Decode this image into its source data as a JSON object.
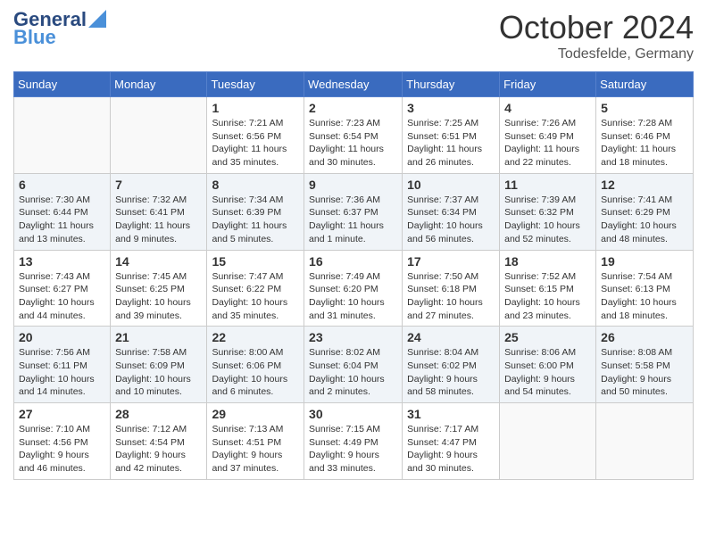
{
  "header": {
    "logo_line1": "General",
    "logo_line2": "Blue",
    "month": "October 2024",
    "location": "Todesfelde, Germany"
  },
  "days_of_week": [
    "Sunday",
    "Monday",
    "Tuesday",
    "Wednesday",
    "Thursday",
    "Friday",
    "Saturday"
  ],
  "weeks": [
    [
      {
        "day": "",
        "content": ""
      },
      {
        "day": "",
        "content": ""
      },
      {
        "day": "1",
        "content": "Sunrise: 7:21 AM\nSunset: 6:56 PM\nDaylight: 11 hours and 35 minutes."
      },
      {
        "day": "2",
        "content": "Sunrise: 7:23 AM\nSunset: 6:54 PM\nDaylight: 11 hours and 30 minutes."
      },
      {
        "day": "3",
        "content": "Sunrise: 7:25 AM\nSunset: 6:51 PM\nDaylight: 11 hours and 26 minutes."
      },
      {
        "day": "4",
        "content": "Sunrise: 7:26 AM\nSunset: 6:49 PM\nDaylight: 11 hours and 22 minutes."
      },
      {
        "day": "5",
        "content": "Sunrise: 7:28 AM\nSunset: 6:46 PM\nDaylight: 11 hours and 18 minutes."
      }
    ],
    [
      {
        "day": "6",
        "content": "Sunrise: 7:30 AM\nSunset: 6:44 PM\nDaylight: 11 hours and 13 minutes."
      },
      {
        "day": "7",
        "content": "Sunrise: 7:32 AM\nSunset: 6:41 PM\nDaylight: 11 hours and 9 minutes."
      },
      {
        "day": "8",
        "content": "Sunrise: 7:34 AM\nSunset: 6:39 PM\nDaylight: 11 hours and 5 minutes."
      },
      {
        "day": "9",
        "content": "Sunrise: 7:36 AM\nSunset: 6:37 PM\nDaylight: 11 hours and 1 minute."
      },
      {
        "day": "10",
        "content": "Sunrise: 7:37 AM\nSunset: 6:34 PM\nDaylight: 10 hours and 56 minutes."
      },
      {
        "day": "11",
        "content": "Sunrise: 7:39 AM\nSunset: 6:32 PM\nDaylight: 10 hours and 52 minutes."
      },
      {
        "day": "12",
        "content": "Sunrise: 7:41 AM\nSunset: 6:29 PM\nDaylight: 10 hours and 48 minutes."
      }
    ],
    [
      {
        "day": "13",
        "content": "Sunrise: 7:43 AM\nSunset: 6:27 PM\nDaylight: 10 hours and 44 minutes."
      },
      {
        "day": "14",
        "content": "Sunrise: 7:45 AM\nSunset: 6:25 PM\nDaylight: 10 hours and 39 minutes."
      },
      {
        "day": "15",
        "content": "Sunrise: 7:47 AM\nSunset: 6:22 PM\nDaylight: 10 hours and 35 minutes."
      },
      {
        "day": "16",
        "content": "Sunrise: 7:49 AM\nSunset: 6:20 PM\nDaylight: 10 hours and 31 minutes."
      },
      {
        "day": "17",
        "content": "Sunrise: 7:50 AM\nSunset: 6:18 PM\nDaylight: 10 hours and 27 minutes."
      },
      {
        "day": "18",
        "content": "Sunrise: 7:52 AM\nSunset: 6:15 PM\nDaylight: 10 hours and 23 minutes."
      },
      {
        "day": "19",
        "content": "Sunrise: 7:54 AM\nSunset: 6:13 PM\nDaylight: 10 hours and 18 minutes."
      }
    ],
    [
      {
        "day": "20",
        "content": "Sunrise: 7:56 AM\nSunset: 6:11 PM\nDaylight: 10 hours and 14 minutes."
      },
      {
        "day": "21",
        "content": "Sunrise: 7:58 AM\nSunset: 6:09 PM\nDaylight: 10 hours and 10 minutes."
      },
      {
        "day": "22",
        "content": "Sunrise: 8:00 AM\nSunset: 6:06 PM\nDaylight: 10 hours and 6 minutes."
      },
      {
        "day": "23",
        "content": "Sunrise: 8:02 AM\nSunset: 6:04 PM\nDaylight: 10 hours and 2 minutes."
      },
      {
        "day": "24",
        "content": "Sunrise: 8:04 AM\nSunset: 6:02 PM\nDaylight: 9 hours and 58 minutes."
      },
      {
        "day": "25",
        "content": "Sunrise: 8:06 AM\nSunset: 6:00 PM\nDaylight: 9 hours and 54 minutes."
      },
      {
        "day": "26",
        "content": "Sunrise: 8:08 AM\nSunset: 5:58 PM\nDaylight: 9 hours and 50 minutes."
      }
    ],
    [
      {
        "day": "27",
        "content": "Sunrise: 7:10 AM\nSunset: 4:56 PM\nDaylight: 9 hours and 46 minutes."
      },
      {
        "day": "28",
        "content": "Sunrise: 7:12 AM\nSunset: 4:54 PM\nDaylight: 9 hours and 42 minutes."
      },
      {
        "day": "29",
        "content": "Sunrise: 7:13 AM\nSunset: 4:51 PM\nDaylight: 9 hours and 37 minutes."
      },
      {
        "day": "30",
        "content": "Sunrise: 7:15 AM\nSunset: 4:49 PM\nDaylight: 9 hours and 33 minutes."
      },
      {
        "day": "31",
        "content": "Sunrise: 7:17 AM\nSunset: 4:47 PM\nDaylight: 9 hours and 30 minutes."
      },
      {
        "day": "",
        "content": ""
      },
      {
        "day": "",
        "content": ""
      }
    ]
  ]
}
